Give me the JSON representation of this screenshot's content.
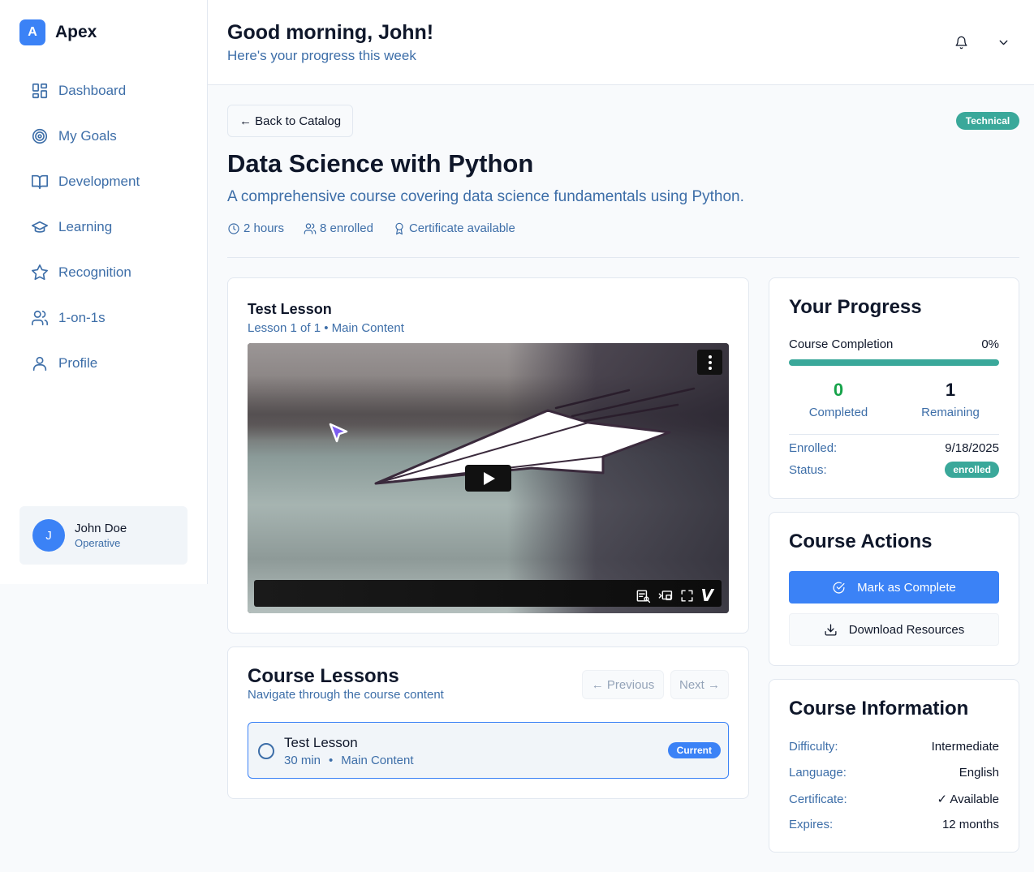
{
  "brand": {
    "logo_letter": "A",
    "name": "Apex",
    "color": "#3b82f6"
  },
  "nav": {
    "items": [
      {
        "label": "Dashboard",
        "icon": "dashboard-icon"
      },
      {
        "label": "My Goals",
        "icon": "target-icon"
      },
      {
        "label": "Development",
        "icon": "book-icon"
      },
      {
        "label": "Learning",
        "icon": "graduation-cap-icon"
      },
      {
        "label": "Recognition",
        "icon": "star-icon"
      },
      {
        "label": "1-on-1s",
        "icon": "users-icon"
      },
      {
        "label": "Profile",
        "icon": "user-icon"
      }
    ]
  },
  "user": {
    "initial": "J",
    "name": "John Doe",
    "role": "Operative"
  },
  "header": {
    "greeting": "Good morning, John!",
    "subtitle": "Here's your progress this week",
    "icons": [
      "bell-icon",
      "chevron-down-icon"
    ]
  },
  "course": {
    "back_label": "← Back to Catalog",
    "category": "Technical",
    "title": "Data Science with Python",
    "description": "A comprehensive course covering data science fundamentals using Python.",
    "duration": "2 hours",
    "enrolled_count": "8 enrolled",
    "certificate": "Certificate available"
  },
  "lesson_player": {
    "title": "Test Lesson",
    "subtitle": "Lesson 1 of 1 • Main Content"
  },
  "lessons": {
    "heading": "Course Lessons",
    "subtitle": "Navigate through the course content",
    "previous_label": "← Previous",
    "next_label": "Next →",
    "items": [
      {
        "title": "Test Lesson",
        "duration": "30 min",
        "section": "Main Content",
        "badge": "Current"
      }
    ]
  },
  "progress": {
    "heading": "Your Progress",
    "completion_label": "Course Completion",
    "completion_pct": "0%",
    "completed_count": "0",
    "completed_label": "Completed",
    "remaining_count": "1",
    "remaining_label": "Remaining",
    "enrolled_label": "Enrolled:",
    "enrolled_date": "9/18/2025",
    "status_label": "Status:",
    "status_value": "enrolled"
  },
  "actions": {
    "heading": "Course Actions",
    "complete_label": "Mark as Complete",
    "download_label": "Download Resources"
  },
  "info": {
    "heading": "Course Information",
    "rows": [
      {
        "key": "Difficulty:",
        "value": "Intermediate"
      },
      {
        "key": "Language:",
        "value": "English"
      },
      {
        "key": "Certificate:",
        "value": "✓ Available"
      },
      {
        "key": "Expires:",
        "value": "12 months"
      }
    ]
  },
  "colors": {
    "accent": "#3b82f6",
    "teal": "#3aa89a",
    "muted_text": "#3d6ea8",
    "green": "#16a34a"
  }
}
